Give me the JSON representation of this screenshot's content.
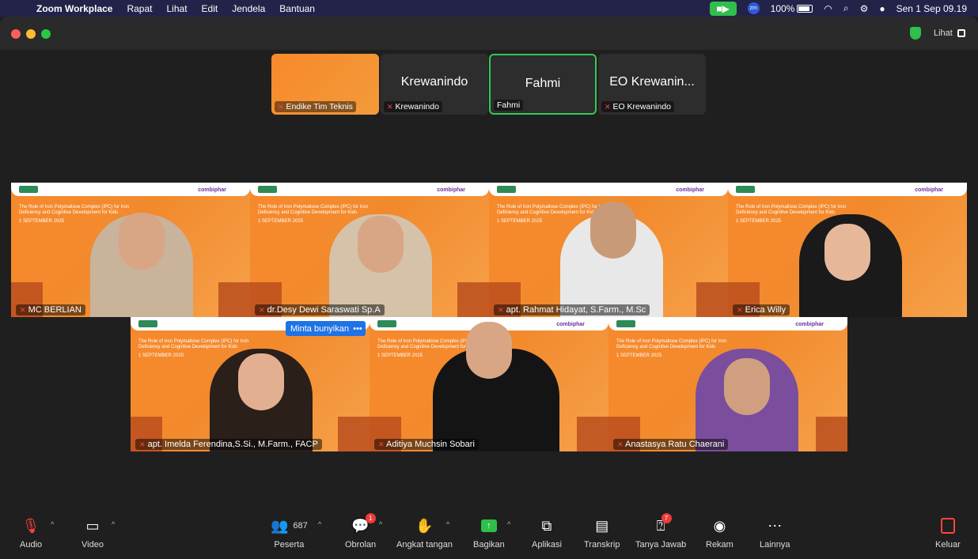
{
  "menubar": {
    "app_name": "Zoom Workplace",
    "menus": [
      "Rapat",
      "Lihat",
      "Edit",
      "Jendela",
      "Bantuan"
    ],
    "battery": "100%",
    "datetime": "Sen 1 Sep  09.19"
  },
  "window": {
    "view_label": "Lihat"
  },
  "strip": [
    {
      "big": "",
      "label": "Endike Tim Teknis"
    },
    {
      "big": "Krewanindo",
      "label": "Krewanindo"
    },
    {
      "big": "Fahmi",
      "label": "Fahmi"
    },
    {
      "big": "EO Krewanin...",
      "label": "EO Krewanindo"
    }
  ],
  "slide": {
    "title": "The Role of Iron Polymaltose Complex (IPC) for Iron Deficiency and Cognitive Development for Kids",
    "date": "1 SEPTEMBER 2025",
    "brand": "combiphar"
  },
  "participants": [
    {
      "name": "MC BERLIAN"
    },
    {
      "name": "dr.Desy Dewi Saraswati Sp.A"
    },
    {
      "name": "apt. Rahmat Hidayat, S.Farm., M.Sc"
    },
    {
      "name": "Erica Willy"
    },
    {
      "name": "apt. Imelda Ferendina,S.Si., M.Farm., FACP"
    },
    {
      "name": "Aditiya Muchsin Sobari"
    },
    {
      "name": "Anastasya Ratu Chaerani"
    }
  ],
  "speaking_popup": {
    "label": "Minta bunyikan",
    "more": "•••"
  },
  "toolbar": {
    "audio": "Audio",
    "video": "Video",
    "participants": "Peserta",
    "participants_count": "687",
    "chat": "Obrolan",
    "chat_badge": "1",
    "raise_hand": "Angkat tangan",
    "share": "Bagikan",
    "apps": "Aplikasi",
    "transcript": "Transkrip",
    "qa": "Tanya Jawab",
    "qa_badge": "7",
    "record": "Rekam",
    "more": "Lainnya",
    "leave": "Keluar"
  },
  "colors": {
    "menubar": "#23234a",
    "accent_green": "#2fbf4a",
    "slide_orange": "#f7892c",
    "popup_blue": "#1f73e6"
  }
}
